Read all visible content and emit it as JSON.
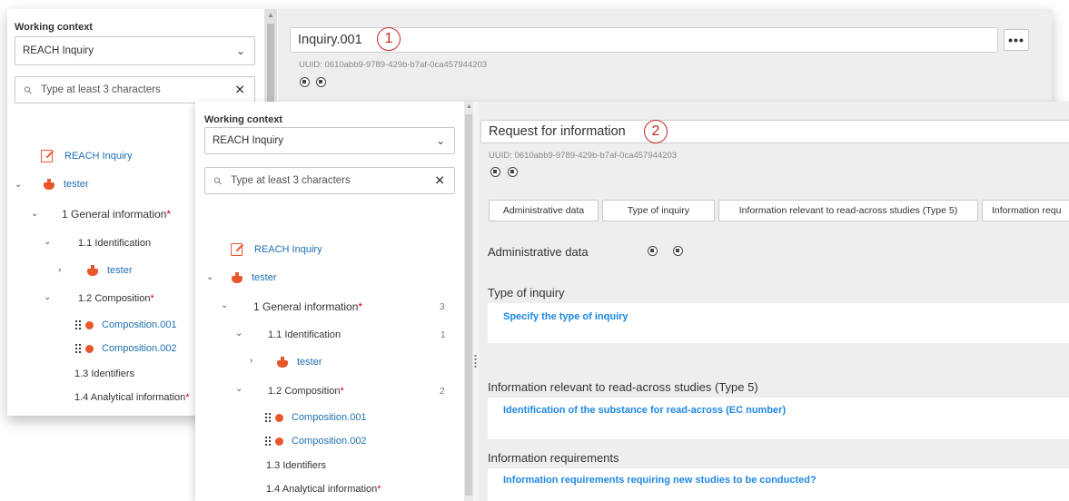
{
  "back": {
    "working_context_label": "Working context",
    "context_value": "REACH Inquiry",
    "search_placeholder": "Type at least 3 characters",
    "tree": {
      "root_label": "REACH Inquiry",
      "user_label": "tester",
      "general_info": "1 General information",
      "identification": "1.1 Identification",
      "identification_child": "tester",
      "composition": "1.2 Composition",
      "composition_1": "Composition.001",
      "composition_2": "Composition.002",
      "identifiers": "1.3 Identifiers",
      "analytical": "1.4 Analytical information"
    },
    "name_value": "Inquiry.001",
    "callout": "1",
    "uuid": "UUID: 0610abb9-9789-429b-b7af-0ca457944203",
    "more_label": "•••"
  },
  "front": {
    "working_context_label": "Working context",
    "context_value": "REACH Inquiry",
    "search_placeholder": "Type at least 3 characters",
    "tree": {
      "root_label": "REACH Inquiry",
      "user_label": "tester",
      "general_info": "1 General information",
      "general_info_count": "3",
      "identification": "1.1 Identification",
      "identification_count": "1",
      "identification_child": "tester",
      "composition": "1.2 Composition",
      "composition_count": "2",
      "composition_1": "Composition.001",
      "composition_2": "Composition.002",
      "identifiers": "1.3 Identifiers",
      "analytical": "1.4 Analytical information"
    },
    "name_value": "Request for information",
    "callout": "2",
    "uuid": "UUID: 0610abb9-9789-429b-b7af-0ca457944203",
    "tabs": [
      "Administrative data",
      "Type of inquiry",
      "Information relevant to read-across studies (Type 5)",
      "Information requ"
    ],
    "sections": {
      "admin_title": "Administrative data",
      "type_title": "Type of inquiry",
      "type_field": "Specify the type of inquiry",
      "readacross_title": "Information relevant to read-across studies (Type 5)",
      "readacross_field": "Identification of the substance for read-across (EC number)",
      "requirements_title": "Information requirements",
      "requirements_field": "Information requirements requiring new studies to be conducted?"
    }
  },
  "required_mark": "*",
  "colors": {
    "accent_link": "#1e6fb3",
    "field_link": "#1e88e5",
    "required": "#d0021b",
    "icon_orange": "#e8572c",
    "callout_red": "#c62828"
  }
}
